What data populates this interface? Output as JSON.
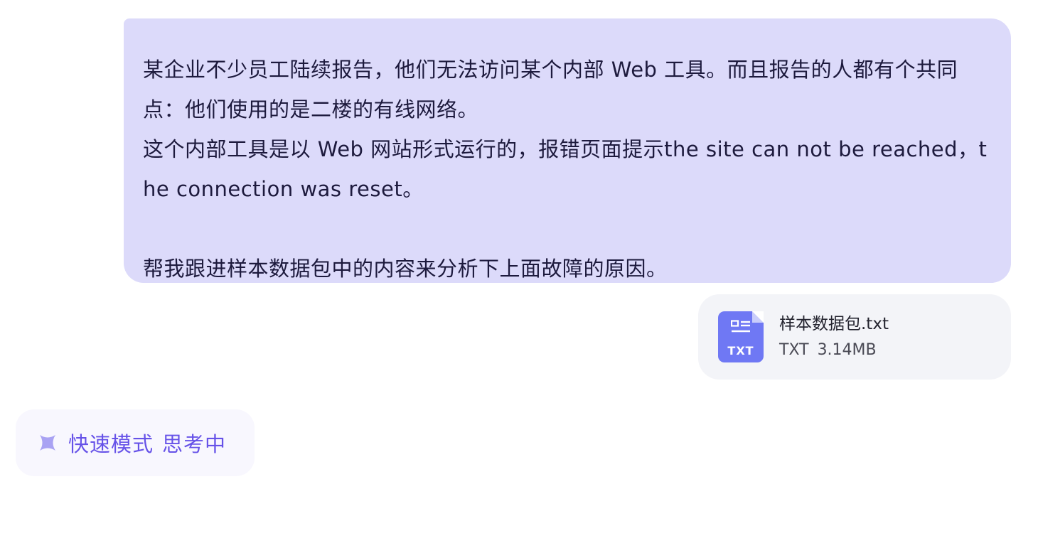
{
  "message": {
    "paragraphs": [
      "某企业不少员工陆续报告，他们无法访问某个内部 Web 工具。而且报告的人都有个共同点：他们使用的是二楼的有线网络。",
      "这个内部工具是以 Web 网站形式运行的，报错页面提示the site can not be reached，the connection was reset。",
      "帮我跟进样本数据包中的内容来分析下上面故障的原因。"
    ]
  },
  "attachment": {
    "icon": "txt-file-icon",
    "icon_label": "TXT",
    "file_name": "样本数据包.txt",
    "file_type": "TXT",
    "file_size": "3.14MB",
    "icon_color": "#6f78f4"
  },
  "status": {
    "icon": "sparkle-icon",
    "mode": "快速模式",
    "state": "思考中",
    "color": "#6652e8"
  },
  "colors": {
    "user_bubble": "#dcdafa",
    "attachment_card": "#f3f4f8",
    "status_pill": "#f8f7fe"
  }
}
